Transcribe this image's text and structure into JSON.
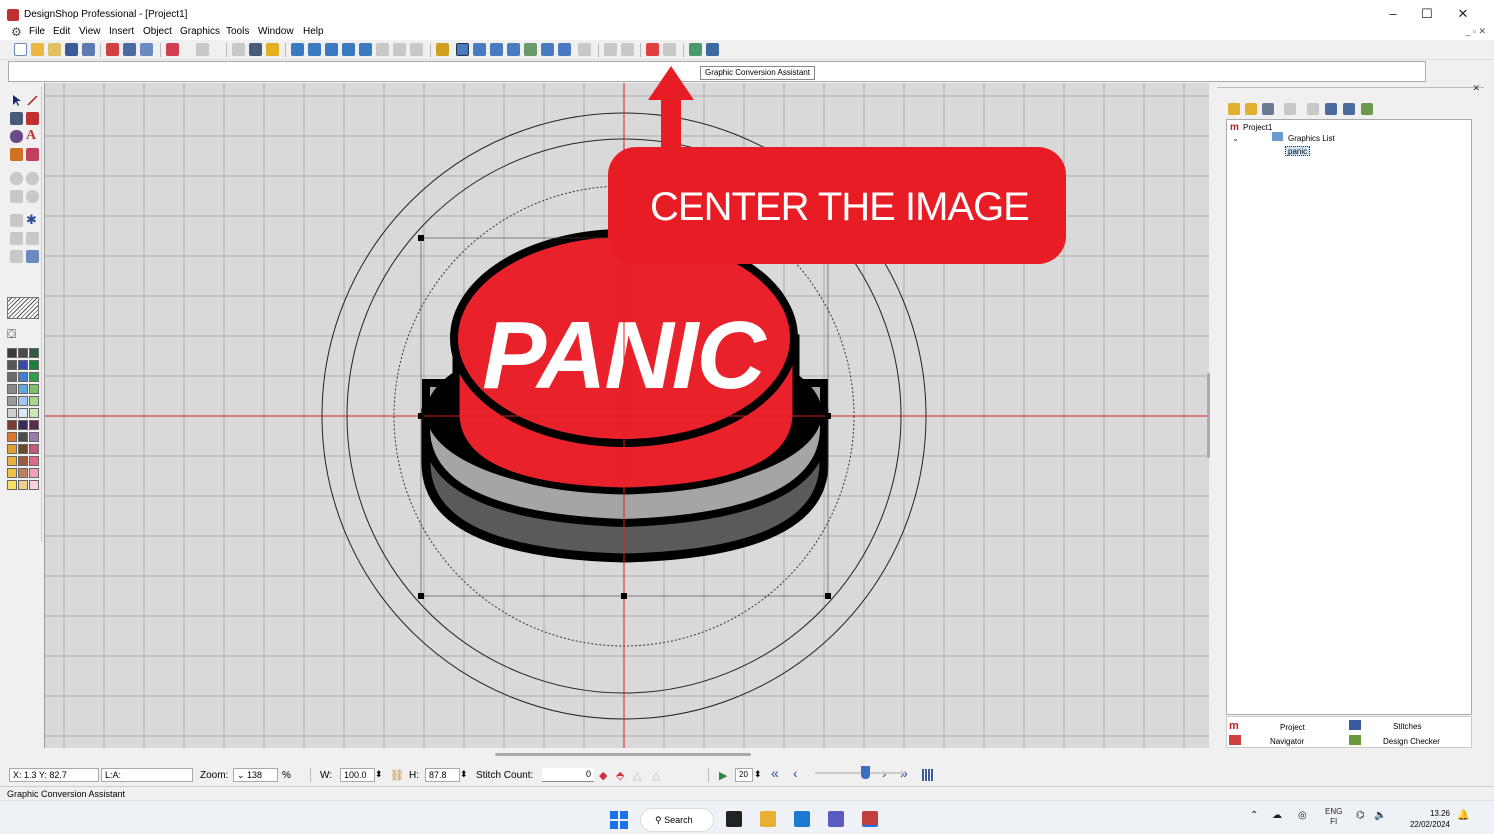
{
  "window": {
    "title": "DesignShop Professional - [Project1]",
    "controls": {
      "minimize": "–",
      "maximize": "☐",
      "close": "✕"
    }
  },
  "menu": {
    "items": [
      "File",
      "Edit",
      "View",
      "Insert",
      "Object",
      "Graphics",
      "Tools",
      "Window",
      "Help"
    ],
    "mdi_controls": "_ ▫ ✕"
  },
  "tooltip": "Graphic Conversion Assistant",
  "callout": {
    "text": "CENTER THE IMAGE",
    "color": "#e81c24"
  },
  "artwork": {
    "word": "PANIC",
    "button_red": "#e8212a",
    "base_light": "#a5a5a5",
    "base_dark": "#5a5a5a"
  },
  "right_panel": {
    "tree": {
      "root": "Project1",
      "graphics_list": "Graphics List",
      "item": "panic"
    },
    "tabs": {
      "project": "Project",
      "stitches": "Stitches",
      "navigator": "Navigator",
      "design_checker": "Design Checker"
    }
  },
  "statusbar": {
    "coords": "X: 1.3  Y: 82.7",
    "layer": "L:A:",
    "zoom_label": "Zoom:",
    "zoom_value": "138",
    "zoom_unit": "%",
    "w_label": "W:",
    "w_value": "100.0",
    "h_label": "H:",
    "h_value": "87.8",
    "stitch_label": "Stitch Count:",
    "stitch_value": "0",
    "speed_value": "20",
    "slider_level": 0.55
  },
  "bottom_status": "Graphic Conversion Assistant",
  "taskbar": {
    "search": "Search",
    "lang_top": "ENG",
    "lang_bottom": "FI",
    "time": "13.26",
    "date": "22/02/2024"
  },
  "palette": {
    "colors": [
      "#3a3a3a",
      "#4a4a4a",
      "#2f5d3b",
      "#555555",
      "#3547a8",
      "#1e7e3e",
      "#6a6a6a",
      "#3f7fd0",
      "#2ea047",
      "#888888",
      "#5fa9e0",
      "#7cc26a",
      "#9a9a9a",
      "#9fc8ee",
      "#a8d68a",
      "#cfcfcf",
      "#d7e8f8",
      "#cde9b8",
      "#7a3c2c",
      "#3a2a5a",
      "#5a2a4a",
      "#e0782a",
      "#4c4c4c",
      "#9a7ab0",
      "#e0a030",
      "#6a4a2a",
      "#c05a7a",
      "#e8b040",
      "#a05a3a",
      "#e06a8a",
      "#f0c040",
      "#c08060",
      "#f0a0c0",
      "#f8e060",
      "#f0d090",
      "#f8d0e0"
    ]
  }
}
